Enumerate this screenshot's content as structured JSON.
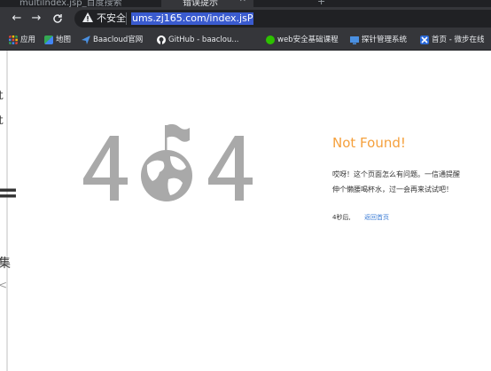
{
  "browser": {
    "tabs": [
      {
        "title": "multiIndex.jsp_百度搜索",
        "active": false
      },
      {
        "title": "错误提示",
        "active": true
      }
    ],
    "address": {
      "security_label": "不安全",
      "url": "ums.zj165.com/index.jsP"
    },
    "bookmarks": [
      {
        "label": "应用",
        "icon": "apps-grid-icon",
        "color": "#ea4335"
      },
      {
        "label": "地图",
        "icon": "maps-icon",
        "color": "#34a853"
      },
      {
        "label": "Baacloud官网",
        "icon": "paper-plane-icon",
        "color": "#4a90e2"
      },
      {
        "label": "GitHub - baaclou...",
        "icon": "github-icon",
        "color": "#ffffff"
      },
      {
        "label": "web安全基础课程",
        "icon": "wechat-icon",
        "color": "#2dc100"
      },
      {
        "label": "探针管理系统",
        "icon": "monitor-icon",
        "color": "#4a90e2"
      },
      {
        "label": "首页 - 微步在线",
        "icon": "x-logo-icon",
        "color": "#2b6ad9"
      }
    ]
  },
  "page": {
    "error_code_art": "404",
    "title": "Not Found!",
    "description_lines": [
      "哎呀！这个页面怎么有问题。一信通提醒",
      "伸个懒腰喝杯水，过一会再来试试吧！"
    ],
    "countdown": "4秒后,",
    "home_link": "返回首页",
    "accent_color": "#f5a03c",
    "link_color": "#3a7bd5",
    "left_fragments": [
      "t",
      "t",
      "=",
      "集",
      "<"
    ]
  }
}
